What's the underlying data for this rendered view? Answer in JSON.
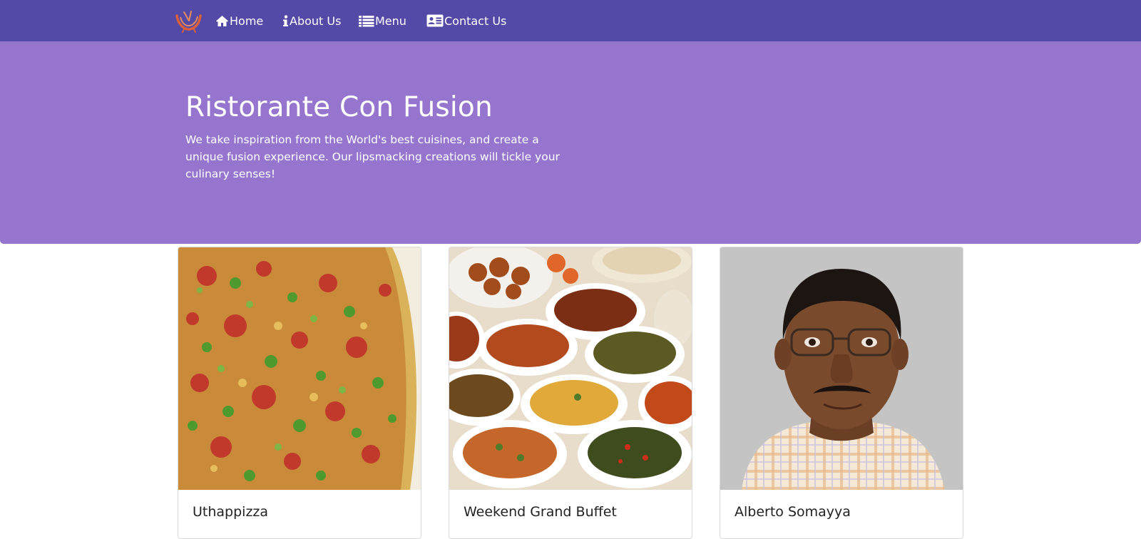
{
  "nav": {
    "items": [
      {
        "label": "Home",
        "icon": "home-icon"
      },
      {
        "label": "About Us",
        "icon": "info-icon"
      },
      {
        "label": "Menu",
        "icon": "list-icon"
      },
      {
        "label": "Contact Us",
        "icon": "address-card-icon"
      }
    ]
  },
  "hero": {
    "title": "Ristorante Con Fusion",
    "description": "We take inspiration from the World's best cuisines, and create a unique fusion experience. Our lipsmacking creations will tickle your culinary senses!"
  },
  "cards": [
    {
      "title": "Uthappizza",
      "image": "pizza-dish"
    },
    {
      "title": "Weekend Grand Buffet",
      "image": "buffet-bowls"
    },
    {
      "title": "Alberto Somayya",
      "image": "chef-portrait"
    }
  ],
  "colors": {
    "navbar": "#524aa6",
    "jumbotron": "#9575cd",
    "text_light": "#ffffff"
  }
}
